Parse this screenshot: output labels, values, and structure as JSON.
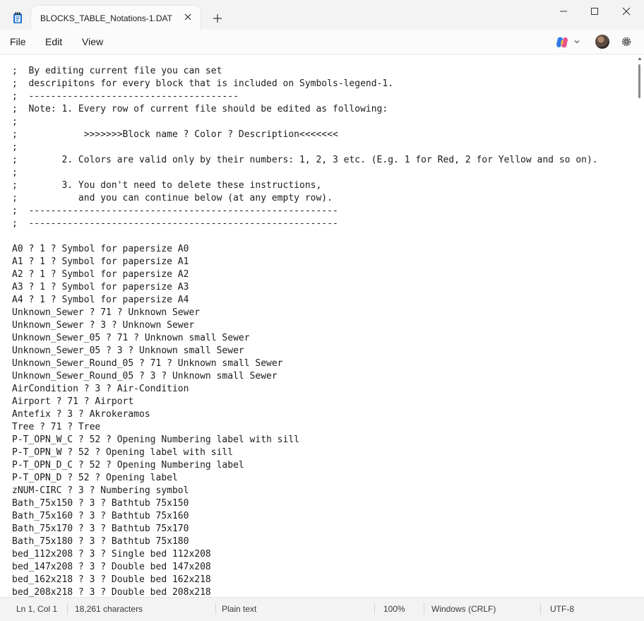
{
  "window": {
    "tab_title": "BLOCKS_TABLE_Notations-1.DAT"
  },
  "menu": {
    "file": "File",
    "edit": "Edit",
    "view": "View"
  },
  "editor": {
    "lines": [
      ";  By editing current file you can set",
      ";  descripitons for every block that is included on Symbols-legend-1.",
      ";  --------------------------------------",
      ";  Note: 1. Every row of current file should be edited as following:",
      ";",
      ";            >>>>>>>Block name ? Color ? Description<<<<<<<",
      ";",
      ";        2. Colors are valid only by their numbers: 1, 2, 3 etc. (E.g. 1 for Red, 2 for Yellow and so on).",
      ";",
      ";        3. You don't need to delete these instructions,",
      ";           and you can continue below (at any empty row).",
      ";  --------------------------------------------------------",
      ";  --------------------------------------------------------",
      "",
      "A0 ? 1 ? Symbol for papersize A0",
      "A1 ? 1 ? Symbol for papersize A1",
      "A2 ? 1 ? Symbol for papersize A2",
      "A3 ? 1 ? Symbol for papersize A3",
      "A4 ? 1 ? Symbol for papersize A4",
      "Unknown_Sewer ? 71 ? Unknown Sewer",
      "Unknown_Sewer ? 3 ? Unknown Sewer",
      "Unknown_Sewer_05 ? 71 ? Unknown small Sewer",
      "Unknown_Sewer_05 ? 3 ? Unknown small Sewer",
      "Unknown_Sewer_Round_05 ? 71 ? Unknown small Sewer",
      "Unknown_Sewer_Round_05 ? 3 ? Unknown small Sewer",
      "AirCondition ? 3 ? Air-Condition",
      "Airport ? 71 ? Airport",
      "Antefix ? 3 ? Akrokeramos",
      "Tree ? 71 ? Tree",
      "P-T_OPN_W_C ? 52 ? Opening Numbering label with sill",
      "P-T_OPN_W ? 52 ? Opening label with sill",
      "P-T_OPN_D_C ? 52 ? Opening Numbering label",
      "P-T_OPN_D ? 52 ? Opening label",
      "zNUM-CIRC ? 3 ? Numbering symbol",
      "Bath_75x150 ? 3 ? Bathtub 75x150",
      "Bath_75x160 ? 3 ? Bathtub 75x160",
      "Bath_75x170 ? 3 ? Bathtub 75x170",
      "Bath_75x180 ? 3 ? Bathtub 75x180",
      "bed_112x208 ? 3 ? Single bed 112x208",
      "bed_147x208 ? 3 ? Double bed 147x208",
      "bed_162x218 ? 3 ? Double bed 162x218",
      "bed_208x218 ? 3 ? Double bed 208x218"
    ]
  },
  "status": {
    "position": "Ln 1, Col 1",
    "characters": "18,261 characters",
    "format": "Plain text",
    "zoom": "100%",
    "line_ending": "Windows (CRLF)",
    "encoding": "UTF-8"
  },
  "colors": {
    "accent": "#1a6fd0",
    "window_bg": "#f3f3f3",
    "editor_bg": "#ffffff"
  }
}
